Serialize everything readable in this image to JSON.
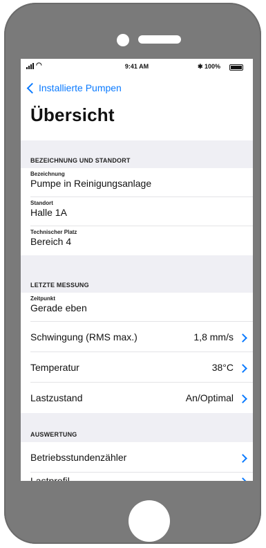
{
  "status_bar": {
    "time": "9:41 AM",
    "bluetooth": "✱",
    "battery": "100%"
  },
  "nav": {
    "back_label": "Installierte Pumpen"
  },
  "page": {
    "title": "Übersicht"
  },
  "section1": {
    "header": "BEZEICHNUNG UND STANDORT",
    "items": [
      {
        "caption": "Bezeichnung",
        "value": "Pumpe in Reinigungsanlage"
      },
      {
        "caption": "Standort",
        "value": "Halle 1A"
      },
      {
        "caption": "Technischer Platz",
        "value": "Bereich 4"
      }
    ]
  },
  "section2": {
    "header": "LETZTE MESSUNG",
    "timestamp": {
      "caption": "Zeitpunkt",
      "value": "Gerade eben"
    },
    "rows": [
      {
        "label": "Schwingung (RMS max.)",
        "value": "1,8 mm/s"
      },
      {
        "label": "Temperatur",
        "value": "38°C"
      },
      {
        "label": "Lastzustand",
        "value": "An/Optimal"
      }
    ]
  },
  "section3": {
    "header": "AUSWERTUNG",
    "rows": [
      {
        "label": "Betriebsstundenzähler"
      },
      {
        "label": "Lastprofil"
      }
    ]
  },
  "colors": {
    "accent": "#0a7aff",
    "group_bg": "#efeff4",
    "device": "#7a7a7a"
  }
}
